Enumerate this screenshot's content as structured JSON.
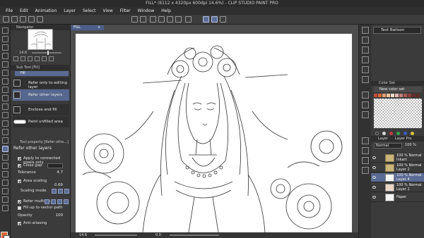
{
  "window": {
    "title": "FILL* (6112 x 4320px 600dpi 14.6%) - CLIP STUDIO PAINT PRO"
  },
  "menu": [
    "File",
    "Edit",
    "Animation",
    "Layer",
    "Select",
    "View",
    "Filter",
    "Window",
    "Help"
  ],
  "navigator": {
    "tab_label": "Navigator",
    "zoom_value": "14.6"
  },
  "sub_tool": {
    "tab_label": "Sub Tool [Fill]",
    "group_label": "Fill",
    "items": [
      {
        "label": "Refer only to editing layer"
      },
      {
        "label": "Refer other layers"
      },
      {
        "label": "Enclose and fill"
      },
      {
        "label": "Paint unfilled area"
      }
    ]
  },
  "tool_property": {
    "tab_label": "Tool property [Refer othe...]",
    "subtitle": "Refer other layers",
    "rows": {
      "connected": "Apply to connected pixels only",
      "close_gap": "Close gap",
      "tolerance_label": "Tolerance",
      "tolerance_value": "4.7",
      "area_scaling_label": "Area scaling",
      "area_scaling_value": "0.69",
      "scaling_mode": "Scaling mode",
      "refer_multiple": "Refer multiple",
      "fill_vector": "Fill up to vector path",
      "opacity_label": "Opacity",
      "opacity_value": "100",
      "anti_aliasing": "Anti-aliasing"
    }
  },
  "document": {
    "tab_label": "FILL"
  },
  "status": {
    "zoom": "14.6",
    "angle": "0.0"
  },
  "right": {
    "balloon_tool": "Text Balloon",
    "color_set_tab": "Color Set",
    "color_set_name": "New color set",
    "swatches": [
      "#c94a3a",
      "#d86a38",
      "#e3a07a",
      "#f2c6a0",
      "#f5dcc4",
      "#e6b8b0",
      "#c0807a",
      "#a65a52",
      "#8b3d3a",
      "#6a2a2a",
      "#5a2e26",
      "#3d1f1a"
    ],
    "dots": [
      "#2a2a2a",
      "#d8d8d8",
      "#c03a3a",
      "#3aa34a",
      "#3a5ac0",
      "#d8c83a"
    ]
  },
  "layers": {
    "tab_label": "Layer",
    "tab_label2": "Layer Pro",
    "blend": "Normal",
    "opacity": "100 %",
    "rows": [
      {
        "line1": "100 % Normal",
        "line2": "Inkart",
        "type": "folder"
      },
      {
        "line1": "100 % Normal",
        "line2": "Layer 2",
        "type": "folder"
      },
      {
        "line1": "100 % Normal",
        "line2": "Layer 4",
        "type": "layer"
      },
      {
        "line1": "100 % Normal",
        "line2": "Layer 1",
        "type": "art"
      },
      {
        "line1": "Paper",
        "line2": "",
        "type": "paper"
      }
    ]
  }
}
